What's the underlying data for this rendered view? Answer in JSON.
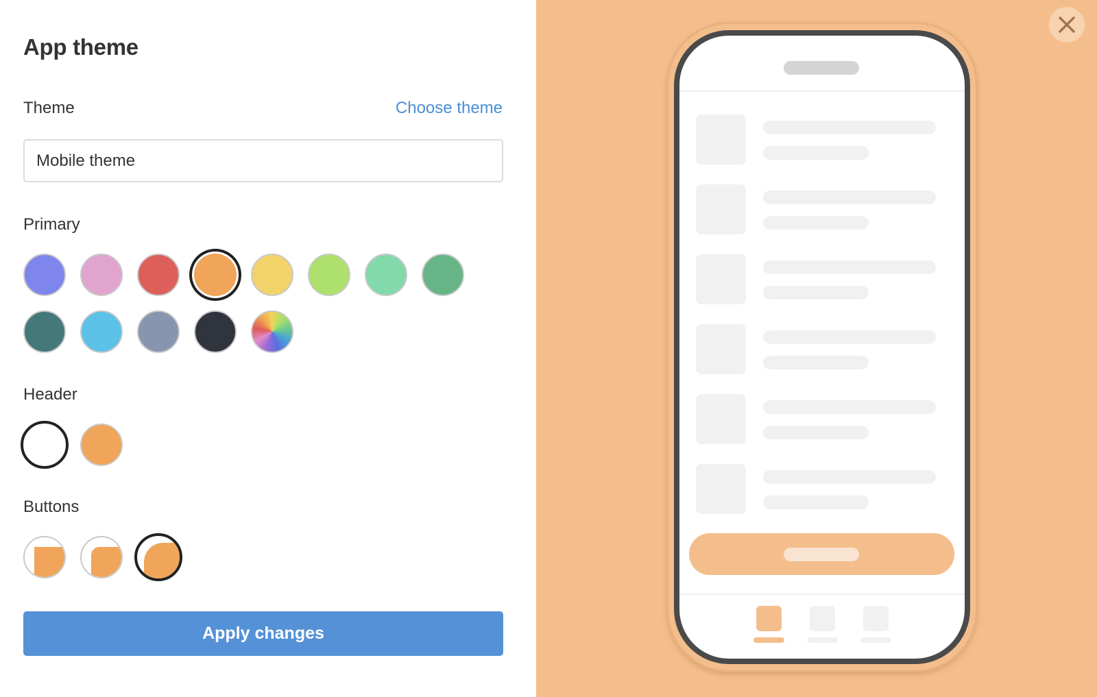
{
  "title": "App theme",
  "theme": {
    "label": "Theme",
    "choose_link": "Choose theme",
    "input_value": "Mobile theme"
  },
  "primary": {
    "label": "Primary",
    "swatches": [
      {
        "name": "indigo",
        "color": "#7e86ee",
        "selected": false
      },
      {
        "name": "pink",
        "color": "#e0a4cf",
        "selected": false
      },
      {
        "name": "red",
        "color": "#dd5f5a",
        "selected": false
      },
      {
        "name": "orange",
        "color": "#f0a55a",
        "selected": true
      },
      {
        "name": "yellow",
        "color": "#f2d36a",
        "selected": false
      },
      {
        "name": "lime",
        "color": "#ade06c",
        "selected": false
      },
      {
        "name": "mint",
        "color": "#82d9a9",
        "selected": false
      },
      {
        "name": "green",
        "color": "#67b487",
        "selected": false
      },
      {
        "name": "teal",
        "color": "#457879",
        "selected": false
      },
      {
        "name": "sky",
        "color": "#5cc1e6",
        "selected": false
      },
      {
        "name": "slate",
        "color": "#8895ae",
        "selected": false
      },
      {
        "name": "charcoal",
        "color": "#30343c",
        "selected": false
      },
      {
        "name": "custom-rainbow",
        "color": "rainbow",
        "selected": false
      }
    ]
  },
  "header": {
    "label": "Header",
    "swatches": [
      {
        "name": "white",
        "color": "#ffffff",
        "selected": true
      },
      {
        "name": "orange",
        "color": "#f0a55a",
        "selected": false
      }
    ]
  },
  "buttons": {
    "label": "Buttons",
    "styles": [
      {
        "name": "square",
        "selected": false
      },
      {
        "name": "rounded",
        "selected": false
      },
      {
        "name": "pill",
        "selected": true
      }
    ]
  },
  "apply_label": "Apply changes",
  "close_icon": "close-icon",
  "colors": {
    "accent": "#5591d6",
    "link": "#4a8fd4",
    "preview_background": "#f4be8c",
    "phone_frame": "#4a4a4a"
  },
  "preview": {
    "list_rows": 6,
    "tabs": 3,
    "active_tab": 0
  }
}
